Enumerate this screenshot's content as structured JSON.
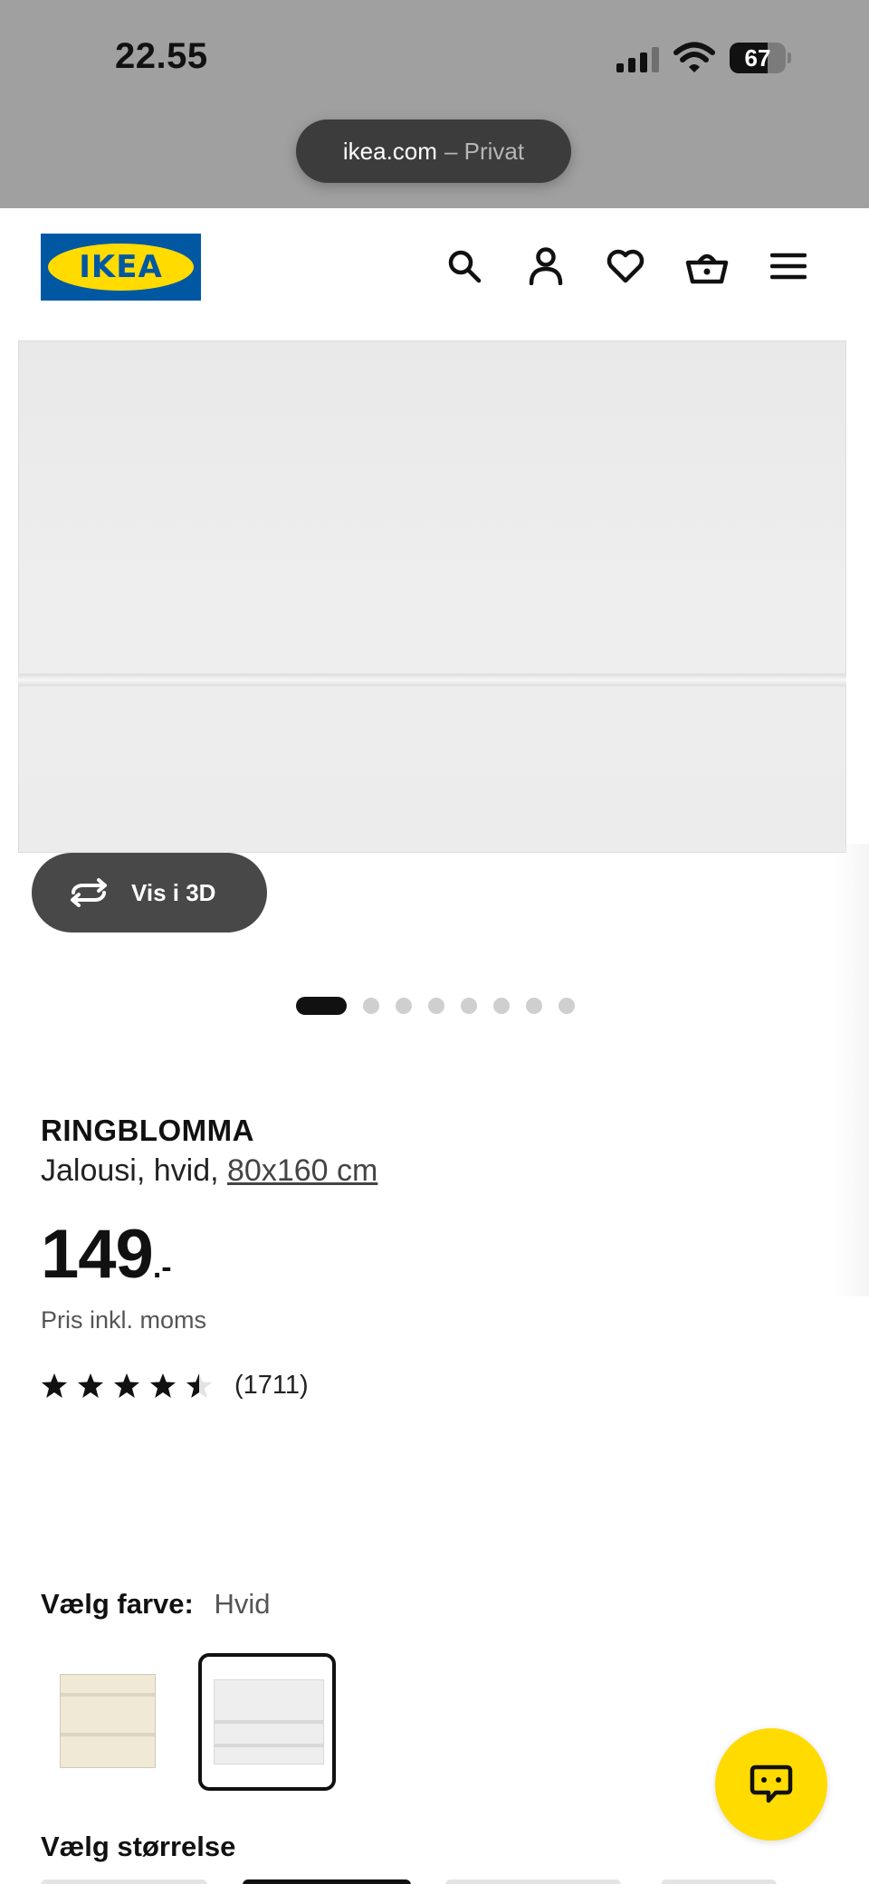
{
  "status_bar": {
    "time": "22.55",
    "battery": "67",
    "battery_level": 0.67,
    "icons": [
      "signal-icon",
      "wifi-icon",
      "battery-icon"
    ]
  },
  "browser": {
    "url": "ikea.com",
    "mode": "– Privat"
  },
  "header": {
    "logo_text": "IKEA",
    "brand_colors": {
      "blue": "#0058a3",
      "yellow": "#ffdb00"
    },
    "icons": [
      "search-icon",
      "account-icon",
      "heart-icon",
      "basket-icon",
      "menu-icon"
    ]
  },
  "gallery": {
    "view3d_label": "Vis i 3D",
    "dot_count": 8,
    "active_index": 0
  },
  "product": {
    "name": "RINGBLOMMA",
    "description": "Jalousi, hvid,",
    "size_link": "80x160 cm",
    "price_integer": "149",
    "price_decimal": ".-",
    "vat_note": "Pris inkl. moms",
    "rating_value": 4.5,
    "rating_max": 5,
    "review_count": "(1711)"
  },
  "color_selector": {
    "label": "Vælg farve:",
    "selected_value": "Hvid",
    "swatches": [
      {
        "name": "beige",
        "selected": false,
        "color": "#efe9d6"
      },
      {
        "name": "hvid",
        "selected": true,
        "color": "#eeeeee"
      }
    ]
  },
  "size_selector": {
    "label": "Vælg størrelse"
  },
  "chat": {
    "icon": "chat-icon",
    "color": "#ffdb00"
  }
}
